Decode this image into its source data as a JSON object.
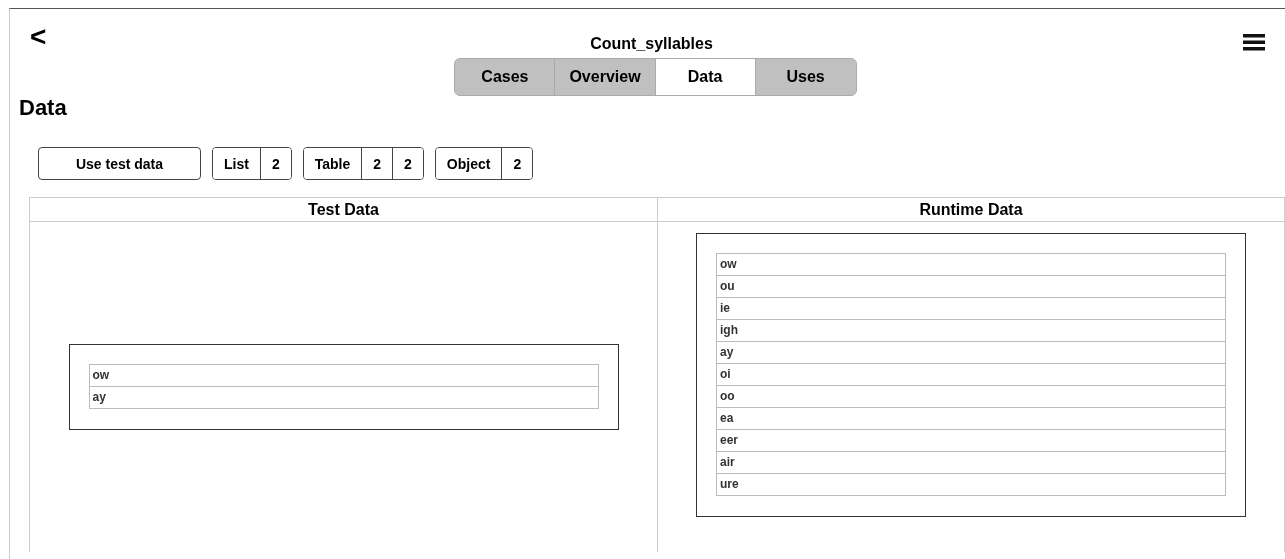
{
  "header": {
    "back": "<",
    "title": "Count_syllables"
  },
  "tabs": [
    {
      "label": "Cases",
      "selected": false
    },
    {
      "label": "Overview",
      "selected": false
    },
    {
      "label": "Data",
      "selected": true
    },
    {
      "label": "Uses",
      "selected": false
    }
  ],
  "heading": "Data",
  "toolbar": [
    {
      "kind": "button",
      "label": "Use test data"
    },
    {
      "kind": "group",
      "segments": [
        "List",
        "2"
      ]
    },
    {
      "kind": "group",
      "segments": [
        "Table",
        "2",
        "2"
      ]
    },
    {
      "kind": "group",
      "segments": [
        "Object",
        "2"
      ]
    }
  ],
  "columns": [
    {
      "title": "Test Data",
      "rows": [
        "ow",
        "ay"
      ]
    },
    {
      "title": "Runtime Data",
      "rows": [
        "ow",
        "ou",
        "ie",
        "igh",
        "ay",
        "oi",
        "oo",
        "ea",
        "eer",
        "air",
        "ure"
      ]
    }
  ]
}
